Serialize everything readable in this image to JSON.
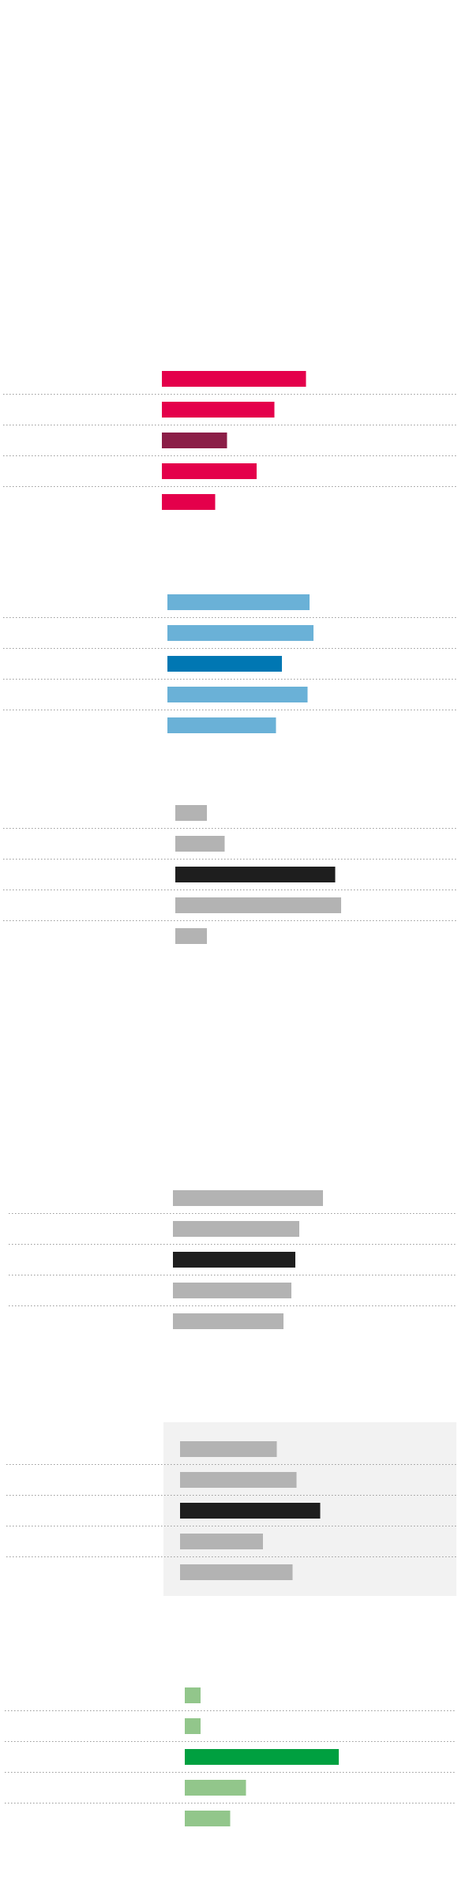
{
  "chart_data": [
    {
      "type": "bar",
      "orientation": "horizontal",
      "title": "",
      "categories": [
        "",
        "",
        "",
        "",
        ""
      ],
      "values": [
        73,
        57,
        33,
        48,
        27
      ],
      "xlim": [
        0,
        100
      ],
      "colors": [
        "#e4004b",
        "#e4004b",
        "#8b1e47",
        "#e4004b",
        "#e4004b"
      ],
      "highlight_index": 2
    },
    {
      "type": "bar",
      "orientation": "horizontal",
      "title": "",
      "categories": [
        "",
        "",
        "",
        "",
        ""
      ],
      "values": [
        72,
        74,
        58,
        71,
        55
      ],
      "xlim": [
        0,
        100
      ],
      "colors": [
        "#6ab1d7",
        "#6ab1d7",
        "#0077b3",
        "#6ab1d7",
        "#6ab1d7"
      ],
      "highlight_index": 2
    },
    {
      "type": "bar",
      "orientation": "horizontal",
      "title": "",
      "categories": [
        "",
        "",
        "",
        "",
        ""
      ],
      "values": [
        16,
        25,
        81,
        84,
        16
      ],
      "xlim": [
        0,
        100
      ],
      "colors": [
        "#b3b3b3",
        "#b3b3b3",
        "#1e1e1e",
        "#b3b3b3",
        "#b3b3b3"
      ],
      "highlight_index": 2
    },
    {
      "type": "bar",
      "orientation": "horizontal",
      "title": "",
      "categories": [
        "",
        "",
        "",
        "",
        ""
      ],
      "values": [
        76,
        64,
        62,
        60,
        56
      ],
      "xlim": [
        0,
        100
      ],
      "colors": [
        "#b3b3b3",
        "#b3b3b3",
        "#1e1e1e",
        "#b3b3b3",
        "#b3b3b3"
      ],
      "highlight_index": 2
    },
    {
      "type": "bar",
      "orientation": "horizontal",
      "title": "",
      "categories": [
        "",
        "",
        "",
        "",
        ""
      ],
      "values": [
        49,
        59,
        71,
        42,
        57
      ],
      "xlim": [
        0,
        100
      ],
      "colors": [
        "#b3b3b3",
        "#b3b3b3",
        "#1e1e1e",
        "#b3b3b3",
        "#b3b3b3"
      ],
      "highlight_index": 2,
      "panel_background": "#f2f2f2"
    },
    {
      "type": "bar",
      "orientation": "horizontal",
      "title": "",
      "categories": [
        "",
        "",
        "",
        "",
        ""
      ],
      "values": [
        8,
        8,
        78,
        31,
        23
      ],
      "xlim": [
        0,
        100
      ],
      "colors": [
        "#92c68b",
        "#92c68b",
        "#00a040",
        "#92c68b",
        "#92c68b"
      ],
      "highlight_index": 2
    }
  ]
}
